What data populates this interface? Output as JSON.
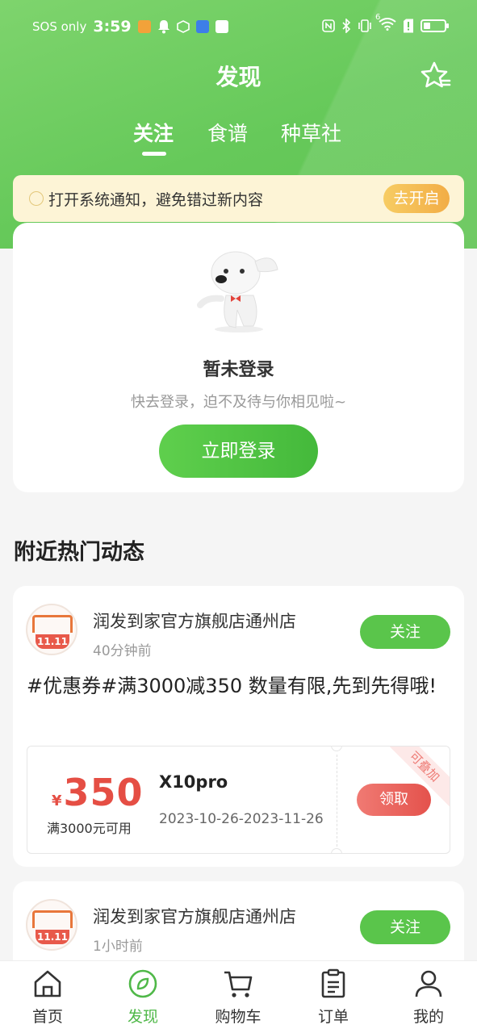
{
  "status_bar": {
    "carrier": "SOS only",
    "time": "3:59",
    "network_badge": "6"
  },
  "header": {
    "title": "发现",
    "tabs": [
      {
        "label": "关注",
        "active": true
      },
      {
        "label": "食谱",
        "active": false
      },
      {
        "label": "种草社",
        "active": false
      }
    ]
  },
  "notice": {
    "text": "打开系统通知，避免错过新内容",
    "button": "去开启"
  },
  "login": {
    "title": "暂未登录",
    "subtitle": "快去登录，迫不及待与你相见啦~",
    "button": "立即登录"
  },
  "section": {
    "title": "附近热门动态"
  },
  "posts": [
    {
      "store": "润发到家官方旗舰店通州店",
      "time": "40分钟前",
      "follow": "关注",
      "avatar_badge": "11.11",
      "text": "#优惠券#满3000减350 数量有限,先到先得哦!",
      "coupon": {
        "currency": "¥",
        "amount": "350",
        "condition": "满3000元可用",
        "title": "X10pro",
        "date": "2023-10-26-2023-11-26",
        "claim": "领取",
        "stack": "可叠加"
      }
    },
    {
      "store": "润发到家官方旗舰店通州店",
      "time": "1小时前",
      "follow": "关注",
      "avatar_badge": "11.11"
    }
  ],
  "bottom_nav": [
    {
      "label": "首页",
      "icon": "home-icon",
      "active": false
    },
    {
      "label": "发现",
      "icon": "compass-icon",
      "active": true
    },
    {
      "label": "购物车",
      "icon": "cart-icon",
      "active": false
    },
    {
      "label": "订单",
      "icon": "order-icon",
      "active": false
    },
    {
      "label": "我的",
      "icon": "user-icon",
      "active": false
    }
  ],
  "colors": {
    "brand_green": "#5ac54b",
    "coupon_red": "#e54e44",
    "notice_bg": "#fdf4d6"
  }
}
